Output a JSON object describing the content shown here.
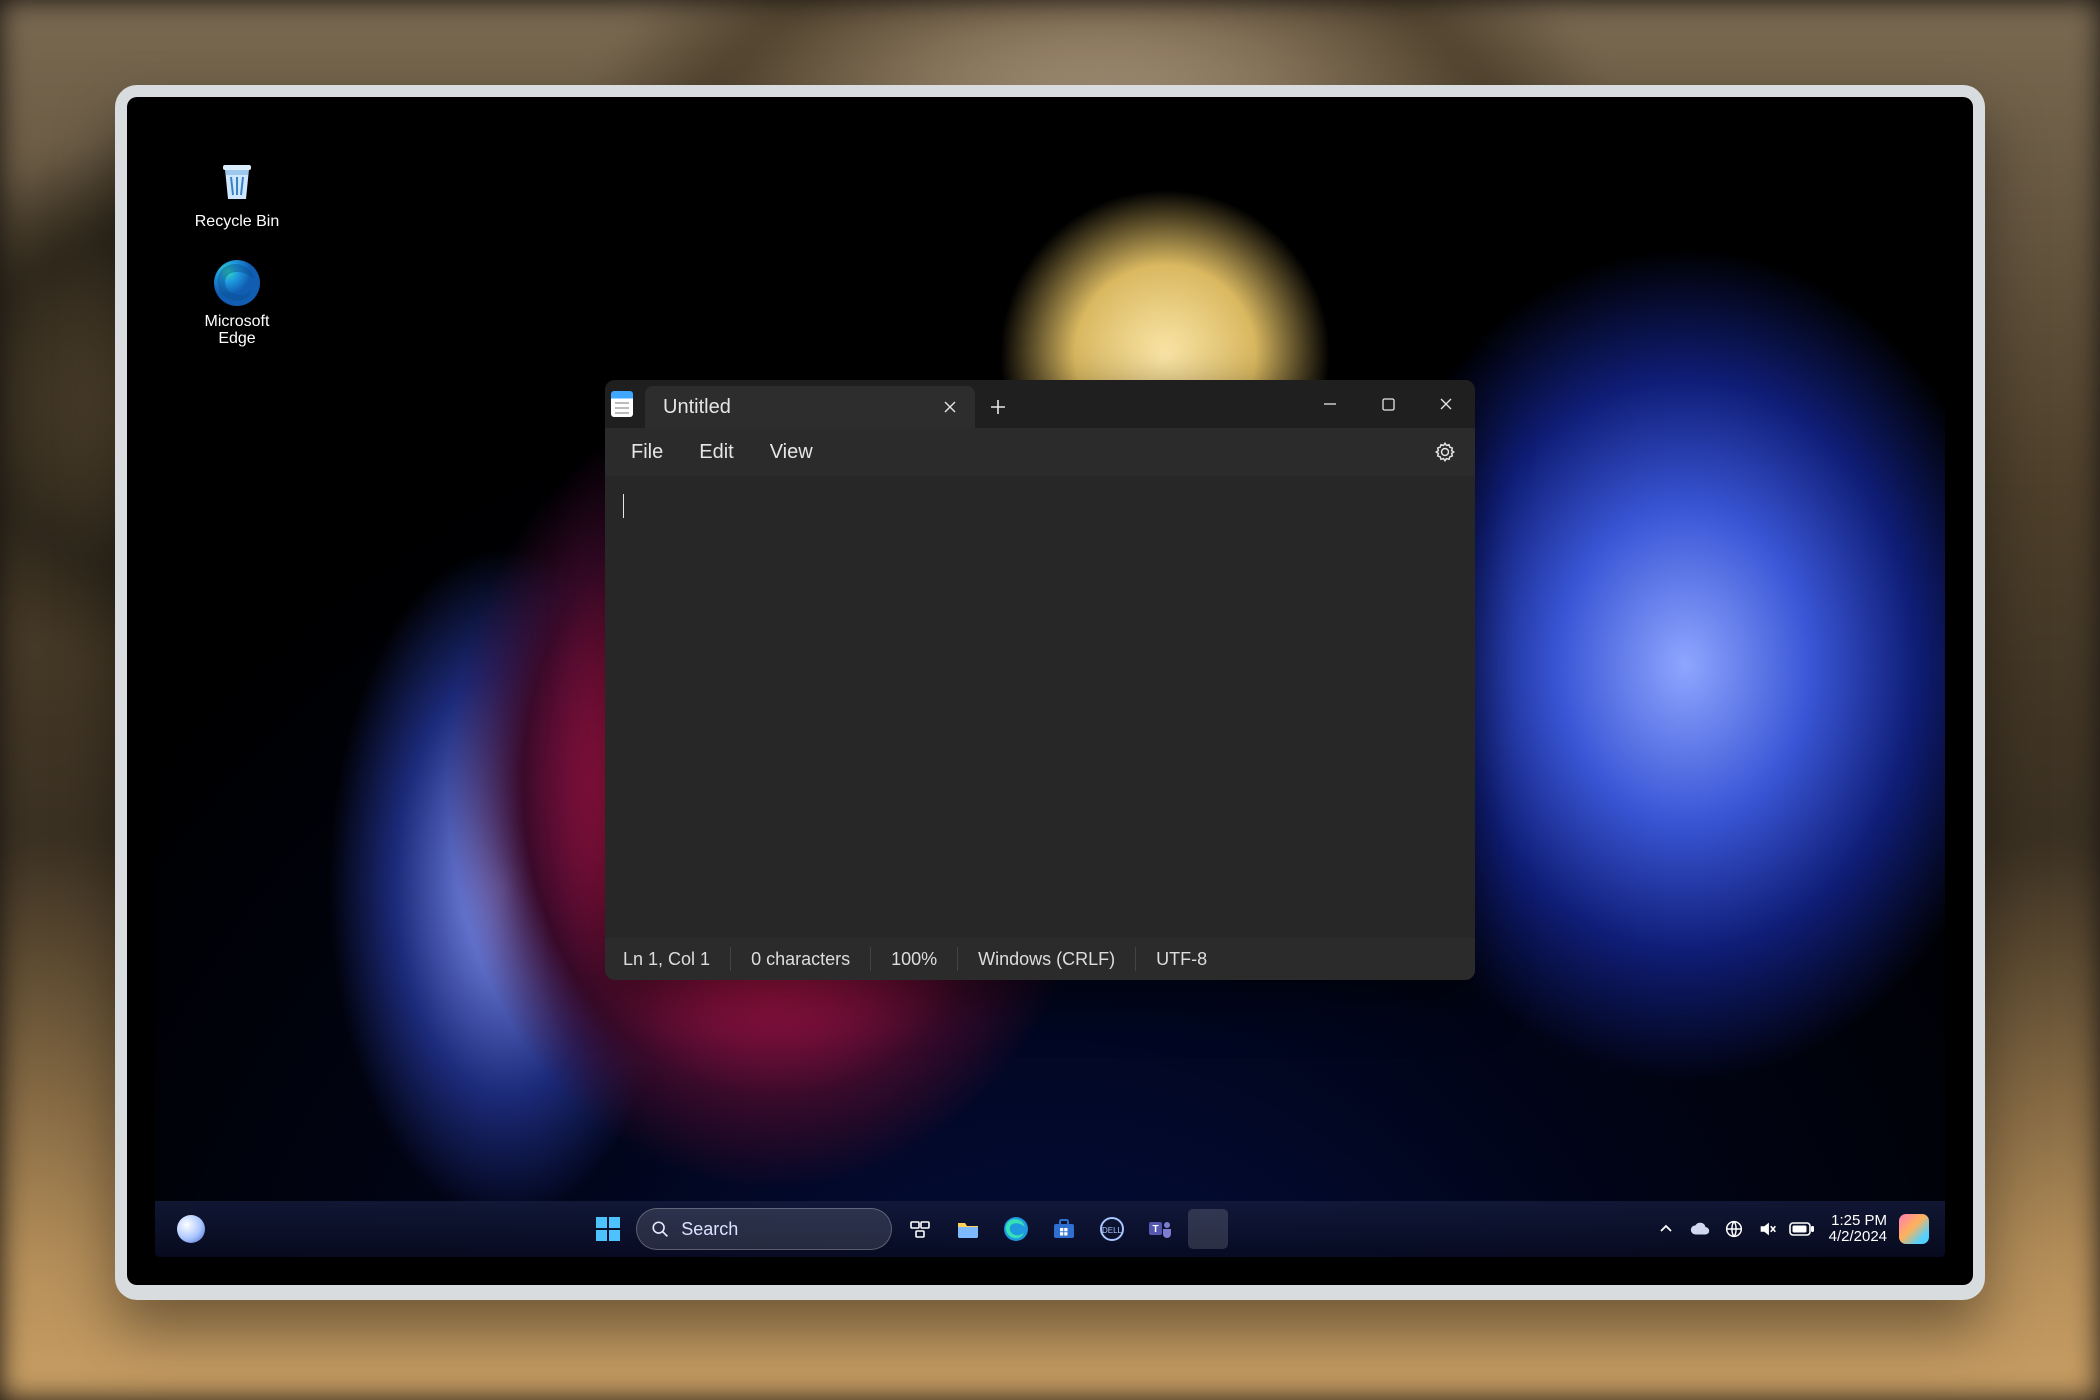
{
  "desktop": {
    "icons": [
      {
        "id": "recycle-bin",
        "label": "Recycle Bin"
      },
      {
        "id": "microsoft-edge",
        "label": "Microsoft Edge"
      }
    ]
  },
  "notepad": {
    "tab_title": "Untitled",
    "menu": {
      "file": "File",
      "edit": "Edit",
      "view": "View"
    },
    "editor_content": "",
    "status": {
      "position": "Ln 1, Col 1",
      "characters": "0 characters",
      "zoom": "100%",
      "line_ending": "Windows (CRLF)",
      "encoding": "UTF-8"
    }
  },
  "taskbar": {
    "search_placeholder": "Search",
    "pinned": [
      {
        "id": "task-view",
        "name": "task-view-icon"
      },
      {
        "id": "file-explorer",
        "name": "file-explorer-icon"
      },
      {
        "id": "edge",
        "name": "edge-icon"
      },
      {
        "id": "store",
        "name": "microsoft-store-icon"
      },
      {
        "id": "dell",
        "name": "dell-app-icon"
      },
      {
        "id": "teams",
        "name": "teams-icon"
      },
      {
        "id": "notepad",
        "name": "notepad-icon"
      }
    ],
    "clock": {
      "time": "1:25 PM",
      "date": "4/2/2024"
    }
  },
  "colors": {
    "win_accent": "#4cc2ff",
    "window_bg": "#272727",
    "close_hover": "#c42b1c"
  }
}
